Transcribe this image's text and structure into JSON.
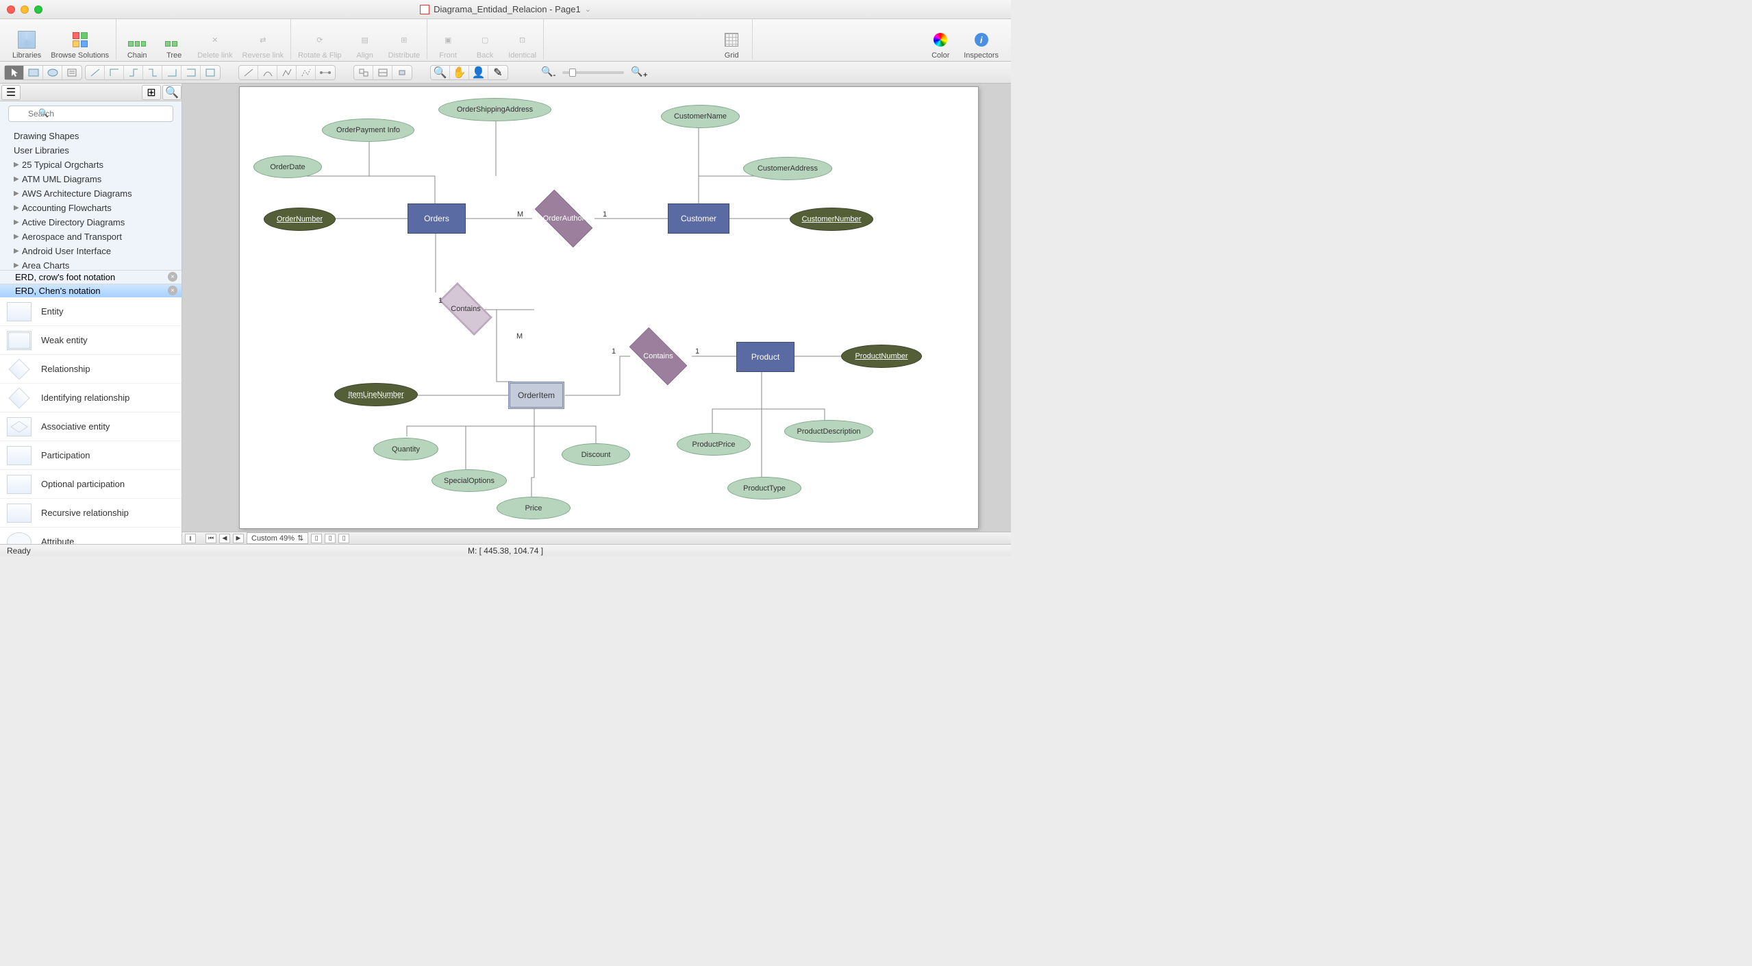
{
  "titlebar": {
    "title": "Diagrama_Entidad_Relacion - Page1"
  },
  "toolbar": {
    "libraries": "Libraries",
    "browse": "Browse Solutions",
    "chain": "Chain",
    "tree": "Tree",
    "delete_link": "Delete link",
    "reverse_link": "Reverse link",
    "rotate_flip": "Rotate & Flip",
    "align": "Align",
    "distribute": "Distribute",
    "front": "Front",
    "back": "Back",
    "identical": "Identical",
    "grid": "Grid",
    "color": "Color",
    "inspectors": "Inspectors"
  },
  "sidebar": {
    "search_placeholder": "Search",
    "categories": [
      "Drawing Shapes",
      "User Libraries",
      "25 Typical Orgcharts",
      "ATM UML Diagrams",
      "AWS Architecture Diagrams",
      "Accounting Flowcharts",
      "Active Directory Diagrams",
      "Aerospace and Transport",
      "Android User Interface",
      "Area Charts"
    ],
    "tab_crows": "ERD, crow's foot notation",
    "tab_chen": "ERD, Chen's notation",
    "stencils": [
      "Entity",
      "Weak entity",
      "Relationship",
      "Identifying relationship",
      "Associative entity",
      "Participation",
      "Optional participation",
      "Recursive relationship",
      "Attribute"
    ]
  },
  "diagram": {
    "entities": {
      "orders": "Orders",
      "customer": "Customer",
      "product": "Product",
      "orderitem": "OrderItem"
    },
    "relationships": {
      "orderauthor": "OrderAuthor",
      "contains1": "Contains",
      "contains2": "Contains"
    },
    "attributes": {
      "orderdate": "OrderDate",
      "orderpayment": "OrderPayment Info",
      "ordershipping": "OrderShippingAddress",
      "ordernumber": "OrderNumber",
      "customername": "CustomerName",
      "customeraddress": "CustomerAddress",
      "customernumber": "CustomerNumber",
      "itemlinenumber": "ItemLineNumber",
      "quantity": "Quantity",
      "specialoptions": "SpecialOptions",
      "price": "Price",
      "discount": "Discount",
      "productprice": "ProductPrice",
      "producttype": "ProductType",
      "productdescription": "ProductDescription",
      "productnumber": "ProductNumber"
    },
    "cardinality": {
      "m1": "M",
      "one": "1"
    }
  },
  "bottom": {
    "zoom_label": "Custom 49%"
  },
  "status": {
    "ready": "Ready",
    "mouse": "M: [ 445.38, 104.74 ]"
  }
}
